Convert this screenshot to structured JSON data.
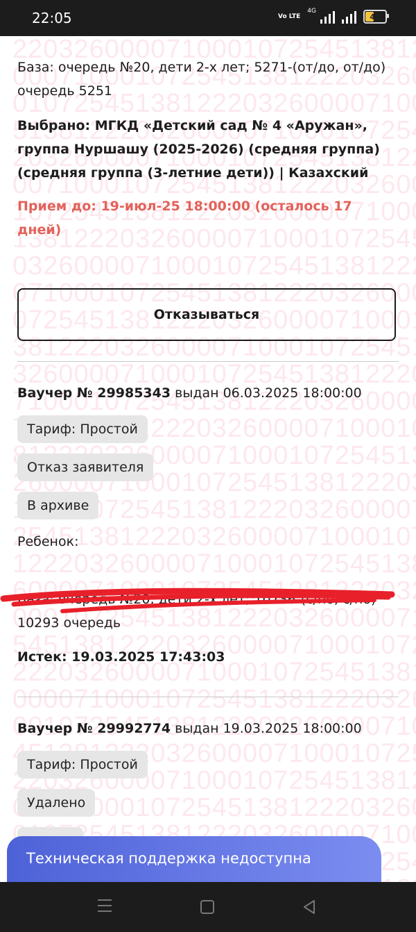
{
  "status": {
    "time": "22:05",
    "volte": "Vo LTE",
    "network": "4G",
    "battery": "41"
  },
  "watermark_text": "220326000071000107254513812",
  "current": {
    "base_line": "База: очередь №20, дети 2-х лет; 5271-(от/до, от/до) очередь 5251",
    "selected_line": "Выбрано: МГКД «Детский сад № 4 «Аружан», группа Нуршашу (2025-2026) (средняя группа) (средняя группа (3-летние дети)) | Казахский",
    "deadline_line": "Прием до: 19-июл-25 18:00:00 (осталось 17 дней)",
    "decline_button": "Отказываться"
  },
  "vouchers": [
    {
      "number_label": "Ваучер № 29985343",
      "issued": "выдан 06.03.2025 18:00:00",
      "chips": [
        "Тариф: Простой",
        "Отказ заявителя",
        "В архиве"
      ],
      "child_label": "Ребенок:",
      "base_line": "База: очередь №20, дети 2-х лет; 10736-(с/по, с/по) 10293 очередь",
      "expired": "Истек: 19.03.2025 17:43:03"
    },
    {
      "number_label": "Ваучер № 29992774",
      "issued": "выдан 19.03.2025 18:00:00",
      "chips": [
        "Тариф: Простой",
        "Удалено"
      ]
    }
  ],
  "support_banner": "Техническая поддержка недоступна",
  "colors": {
    "deadline": "#e2625a",
    "support_banner": "#5a6fe0",
    "watermark": "#f06e8c",
    "scribble": "#e8202a"
  }
}
